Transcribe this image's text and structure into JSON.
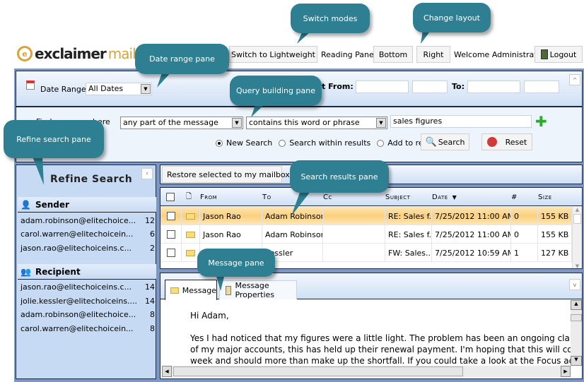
{
  "header": {
    "logo_text": "exclaimer",
    "logo_suffix": "mail a",
    "switch_button": "Switch to Lightweight",
    "reading_pane_label": "Reading Pane:",
    "bottom_button": "Bottom",
    "right_button": "Right",
    "welcome": "Welcome Administrator!",
    "logout_button": "Logout"
  },
  "date_pane": {
    "label": "Date Range:",
    "value": "All Dates",
    "from_label": "t From:",
    "to_label": "To:"
  },
  "query": {
    "find_label": "Find",
    "where_label": "here",
    "field_value": "any part of the message",
    "operator_value": "contains this word or phrase",
    "term_value": "sales figures",
    "modes": [
      "New Search",
      "Search within results",
      "Add to results"
    ],
    "selected_mode": "New Search",
    "search_button": "Search",
    "reset_button": "Reset"
  },
  "refine": {
    "title": "Refine Search",
    "sender_label": "Sender",
    "senders": [
      {
        "email": "adam.robinson@elitechoice...",
        "count": "12"
      },
      {
        "email": "carol.warren@elitechoicein...",
        "count": "6"
      },
      {
        "email": "jason.rao@elitechoiceins.c...",
        "count": "2"
      }
    ],
    "recipient_label": "Recipient",
    "recipients": [
      {
        "email": "jason.rao@elitechoiceins.c...",
        "count": "14"
      },
      {
        "email": "jolie.kessler@elitechoiceins....",
        "count": "14"
      },
      {
        "email": "adam.robinson@elitechoice...",
        "count": "8"
      },
      {
        "email": "carol.warren@elitechoicein...",
        "count": "8"
      }
    ]
  },
  "results": {
    "restore_button": "Restore selected to my mailbox",
    "columns": {
      "from": "From",
      "to": "To",
      "cc": "Cc",
      "subject": "Subject",
      "date": "Date",
      "count": "#",
      "size": "Size"
    },
    "rows": [
      {
        "from": "Jason Rao",
        "to": "Adam Robinson",
        "cc": "",
        "subject": "RE: Sales f...",
        "date": "7/25/2012 11:00 AM",
        "count": "0",
        "size": "155 KB",
        "selected": true
      },
      {
        "from": "Jason Rao",
        "to": "Adam Robinson",
        "cc": "",
        "subject": "RE: Sales f...",
        "date": "7/25/2012 11:00 AM",
        "count": "0",
        "size": "155 KB",
        "selected": false
      },
      {
        "from": "",
        "to": "Kessler",
        "cc": "",
        "subject": "FW: Sales...",
        "date": "7/25/2012 10:59 AM",
        "count": "1",
        "size": "127 KB",
        "selected": false
      }
    ]
  },
  "message": {
    "tabs": [
      "Message",
      "Message Properties"
    ],
    "active_tab": "Message",
    "greeting": "Hi Adam,",
    "lines": [
      "Yes I had noticed that my figures were a little light.  The problem has been an ongoing claim a",
      "of my major accounts, this has held up their renewal payment.  I'm hoping that this will come",
      "week and should more than make up the shortfall.  If you could take a look at the Focus acco"
    ]
  },
  "callouts": {
    "switch_modes": "Switch modes",
    "change_layout": "Change layout",
    "date_range": "Date range pane",
    "query_building": "Query building pane",
    "refine_search": "Refine search pane",
    "search_results": "Search results pane",
    "message_pane": "Message pane"
  },
  "colors": {
    "callout": "#2f7f93",
    "frame": "#7d97c4",
    "pane_bg": "#c7daf3",
    "selected_row": "#fcd78a",
    "logo_gold": "#d9a33a"
  }
}
